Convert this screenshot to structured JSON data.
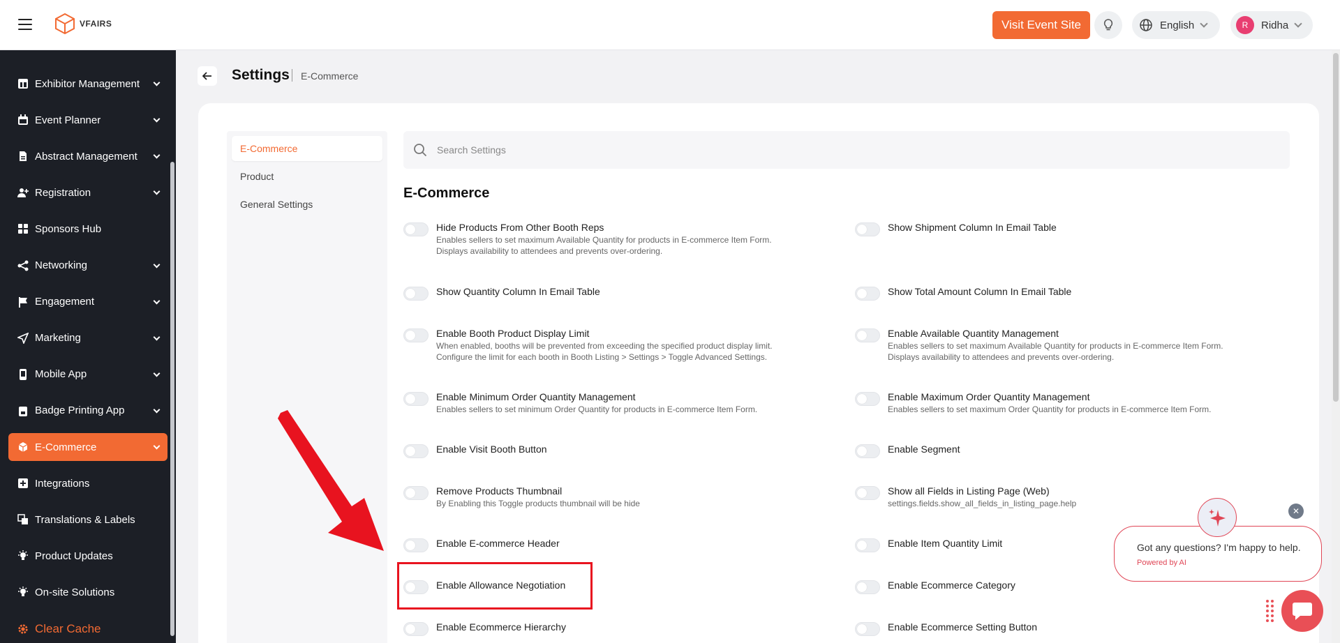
{
  "brand": {
    "logo_text": "VFAIRS"
  },
  "topbar": {
    "visit_label": "Visit Event Site",
    "language": "English",
    "user_initial": "R",
    "user_name": "Ridha"
  },
  "sidebar": {
    "items": [
      {
        "label": "Exhibitor Management",
        "icon": "table-icon",
        "chevron": true
      },
      {
        "label": "Event Planner",
        "icon": "calendar-icon",
        "chevron": true
      },
      {
        "label": "Abstract Management",
        "icon": "document-icon",
        "chevron": true
      },
      {
        "label": "Registration",
        "icon": "user-plus-icon",
        "chevron": true
      },
      {
        "label": "Sponsors Hub",
        "icon": "grid-icon",
        "chevron": false
      },
      {
        "label": "Networking",
        "icon": "share-icon",
        "chevron": true
      },
      {
        "label": "Engagement",
        "icon": "flag-icon",
        "chevron": true
      },
      {
        "label": "Marketing",
        "icon": "send-icon",
        "chevron": true
      },
      {
        "label": "Mobile App",
        "icon": "mobile-icon",
        "chevron": true
      },
      {
        "label": "Badge Printing App",
        "icon": "badge-icon",
        "chevron": true
      },
      {
        "label": "E-Commerce",
        "icon": "cube-icon",
        "chevron": true,
        "active": true
      },
      {
        "label": "Integrations",
        "icon": "plus-square-icon",
        "chevron": false
      },
      {
        "label": "Translations & Labels",
        "icon": "translate-icon",
        "chevron": false
      },
      {
        "label": "Product Updates",
        "icon": "bulb-icon",
        "chevron": false
      },
      {
        "label": "On-site Solutions",
        "icon": "bulb-icon",
        "chevron": false
      }
    ],
    "clear_cache": "Clear Cache"
  },
  "header": {
    "title": "Settings",
    "breadcrumb": "E-Commerce"
  },
  "settings_nav": [
    "E-Commerce",
    "Product",
    "General Settings"
  ],
  "search": {
    "placeholder": "Search Settings"
  },
  "section_title": "E-Commerce",
  "settings": {
    "left": [
      {
        "label": "Hide Products From Other Booth Reps",
        "desc": "Enables sellers to set maximum Available Quantity for products in E-commerce Item Form.\nDisplays availability to attendees and prevents over-ordering."
      },
      {
        "label": "Show Quantity Column In Email Table",
        "desc": ""
      },
      {
        "label": "Enable Booth Product Display Limit",
        "desc": "When enabled, booths will be prevented from exceeding the specified product display limit.\nConfigure the limit for each booth in Booth Listing > Settings > Toggle Advanced Settings."
      },
      {
        "label": "Enable Minimum Order Quantity Management",
        "desc": "Enables sellers to set minimum Order Quantity for products in E-commerce Item Form."
      },
      {
        "label": "Enable Visit Booth Button",
        "desc": ""
      },
      {
        "label": "Remove Products Thumbnail",
        "desc": "By Enabling this Toggle products thumbnail will be hide"
      },
      {
        "label": "Enable E-commerce Header",
        "desc": ""
      },
      {
        "label": "Enable Allowance Negotiation",
        "desc": ""
      },
      {
        "label": "Enable Ecommerce Hierarchy",
        "desc": ""
      }
    ],
    "right": [
      {
        "label": "Show Shipment Column In Email Table",
        "desc": ""
      },
      {
        "label": "Show Total Amount Column In Email Table",
        "desc": ""
      },
      {
        "label": "Enable Available Quantity Management",
        "desc": "Enables sellers to set maximum Available Quantity for products in E-commerce Item Form.\nDisplays availability to attendees and prevents over-ordering."
      },
      {
        "label": "Enable Maximum Order Quantity Management",
        "desc": "Enables sellers to set maximum Order Quantity for products in E-commerce Item Form."
      },
      {
        "label": "Enable Segment",
        "desc": ""
      },
      {
        "label": "Show all Fields in Listing Page (Web)",
        "desc": "settings.fields.show_all_fields_in_listing_page.help"
      },
      {
        "label": "Enable Item Quantity Limit",
        "desc": ""
      },
      {
        "label": "Enable Ecommerce Category",
        "desc": ""
      },
      {
        "label": "Enable Ecommerce Setting Button",
        "desc": ""
      }
    ]
  },
  "chat": {
    "question": "Got any questions? I'm happy to help.",
    "powered": "Powered by AI"
  },
  "colors": {
    "accent": "#f26a33",
    "sidebar_bg": "#1c1f26",
    "highlight": "#e8131f",
    "chat": "#e94f56"
  }
}
